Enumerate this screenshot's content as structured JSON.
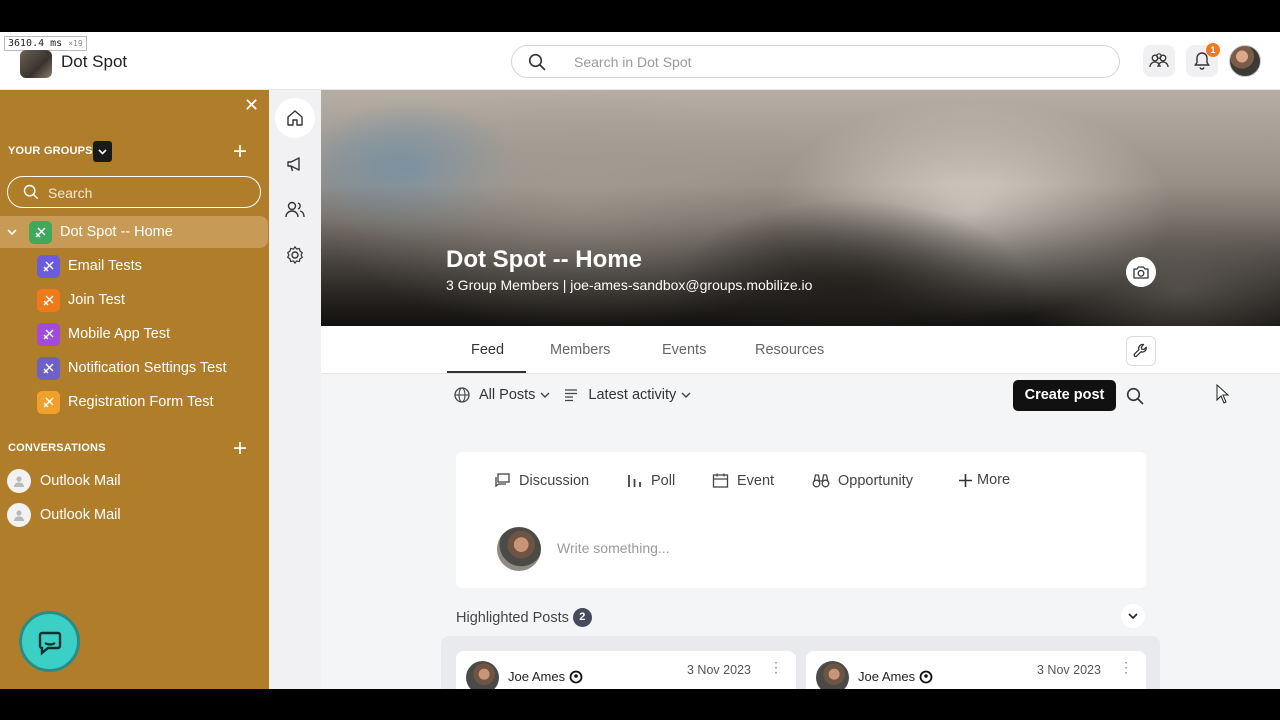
{
  "debug": {
    "time": "3610.4 ms",
    "mult": "×19"
  },
  "topbar": {
    "brand": "Dot Spot",
    "search_placeholder": "Search in Dot Spot",
    "notification_count": "1"
  },
  "sidebar": {
    "groups_header": "YOUR GROUPS",
    "search_placeholder": "Search",
    "groups": [
      {
        "label": "Dot Spot -- Home",
        "color": "#3fa85a"
      },
      {
        "label": "Email Tests",
        "color": "#6b5be0"
      },
      {
        "label": "Join Test",
        "color": "#f07a1a"
      },
      {
        "label": "Mobile App Test",
        "color": "#a24ad9"
      },
      {
        "label": "Notification Settings Test",
        "color": "#6e60c9"
      },
      {
        "label": "Registration Form Test",
        "color": "#f2a02c"
      }
    ],
    "conversations_header": "CONVERSATIONS",
    "conversations": [
      {
        "label": "Outlook Mail"
      },
      {
        "label": "Outlook Mail"
      }
    ]
  },
  "cover": {
    "title": "Dot Spot -- Home",
    "subtitle": "3 Group Members | joe-ames-sandbox@groups.mobilize.io"
  },
  "tabs": [
    "Feed",
    "Members",
    "Events",
    "Resources"
  ],
  "filters": {
    "all_posts": "All Posts",
    "sort": "Latest activity",
    "create_post": "Create post"
  },
  "composer": {
    "types": [
      {
        "label": "Discussion",
        "icon": "discussion-icon"
      },
      {
        "label": "Poll",
        "icon": "poll-icon"
      },
      {
        "label": "Event",
        "icon": "calendar-icon"
      },
      {
        "label": "Opportunity",
        "icon": "binoculars-icon"
      },
      {
        "label": "More",
        "icon": "plus-icon"
      }
    ],
    "placeholder": "Write something..."
  },
  "highlighted": {
    "title": "Highlighted Posts",
    "count": "2",
    "posts": [
      {
        "author": "Joe Ames",
        "date": "3 Nov 2023"
      },
      {
        "author": "Joe Ames",
        "date": "3 Nov 2023"
      }
    ]
  }
}
